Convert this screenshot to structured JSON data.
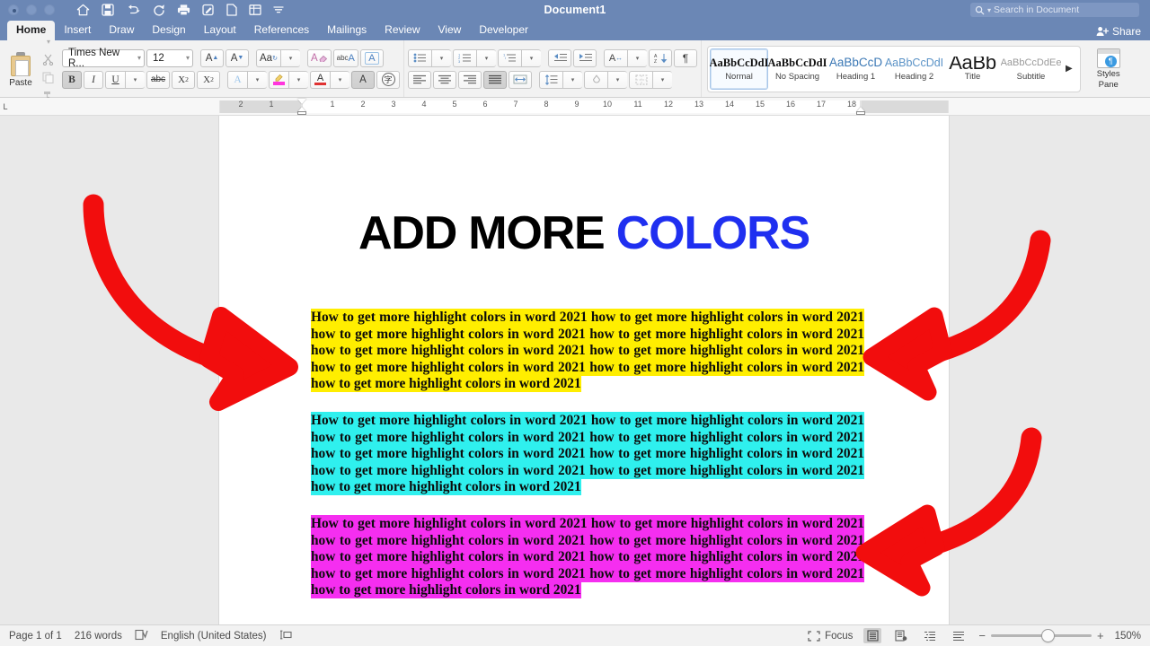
{
  "titlebar": {
    "document_title": "Document1",
    "quick_access": [
      {
        "name": "home-icon",
        "label": "Home"
      },
      {
        "name": "save-icon",
        "label": "Save"
      },
      {
        "name": "undo-icon",
        "label": "Undo"
      },
      {
        "name": "redo-icon",
        "label": "Redo"
      },
      {
        "name": "print-icon",
        "label": "Print"
      },
      {
        "name": "review-icon",
        "label": "Review"
      },
      {
        "name": "new-document-icon",
        "label": "New Document"
      },
      {
        "name": "table-icon",
        "label": "Table"
      },
      {
        "name": "customize-toolbar-icon",
        "label": "Customize"
      }
    ],
    "search_placeholder": "Search in Document",
    "share_label": "Share"
  },
  "tabs": [
    {
      "label": "Home",
      "active": true
    },
    {
      "label": "Insert",
      "active": false
    },
    {
      "label": "Draw",
      "active": false
    },
    {
      "label": "Design",
      "active": false
    },
    {
      "label": "Layout",
      "active": false
    },
    {
      "label": "References",
      "active": false
    },
    {
      "label": "Mailings",
      "active": false
    },
    {
      "label": "Review",
      "active": false
    },
    {
      "label": "View",
      "active": false
    },
    {
      "label": "Developer",
      "active": false
    }
  ],
  "ribbon": {
    "paste_label": "Paste",
    "font_name": "Times New R...",
    "font_size": "12",
    "buttons": {
      "grow_font": "A",
      "shrink_font": "A",
      "change_case": "Aa",
      "clear_formatting": "A",
      "spelling": "abc",
      "text_effects": "A",
      "bold": "B",
      "italic": "I",
      "underline": "U",
      "strikethrough": "abc",
      "subscript": "X",
      "superscript": "X",
      "text_outline": "A",
      "highlight": "A",
      "font_color": "A",
      "shading_char": "A",
      "asian_layout": "字"
    },
    "highlight_color": "#ff35dd",
    "font_color": "#e03232",
    "styles": [
      {
        "preview": "AaBbCcDdI",
        "name": "Normal",
        "selected": true,
        "cls": "s-normal"
      },
      {
        "preview": "AaBbCcDdI",
        "name": "No Spacing",
        "selected": false,
        "cls": "s-nospace"
      },
      {
        "preview": "AaBbCcD",
        "name": "Heading 1",
        "selected": false,
        "cls": "s-h1"
      },
      {
        "preview": "AaBbCcDdI",
        "name": "Heading 2",
        "selected": false,
        "cls": "s-h2"
      },
      {
        "preview": "AaBb",
        "name": "Title",
        "selected": false,
        "cls": "s-title"
      },
      {
        "preview": "AaBbCcDdEe",
        "name": "Subtitle",
        "selected": false,
        "cls": "s-sub"
      }
    ],
    "gallery_more": "▶",
    "styles_pane_label_1": "Styles",
    "styles_pane_label_2": "Pane",
    "styles_pane_badge": "¶"
  },
  "ruler": {
    "corner_mark": "L",
    "left_numbers": [
      "2",
      "1"
    ],
    "numbers": [
      "1",
      "2",
      "3",
      "4",
      "5",
      "6",
      "7",
      "8",
      "9",
      "10",
      "11",
      "12",
      "13",
      "14",
      "15",
      "16",
      "17",
      "18"
    ]
  },
  "document": {
    "heading_black": "ADD MORE",
    "heading_blue": "COLORS",
    "heading_blue_color": "#1f2ff0",
    "body_text": "How to get more highlight colors in word 2021 how to get more highlight colors in word 2021 how to get more highlight colors in word 2021 how to get more highlight colors in word 2021 how to get more highlight colors in word 2021 how to get more highlight colors in word 2021 how to get more highlight colors in word 2021 how to get more highlight colors in word 2021 how to get more highlight colors in word 2021",
    "paragraphs": [
      {
        "name": "paragraph-yellow",
        "highlight": "#ffee00"
      },
      {
        "name": "paragraph-cyan",
        "highlight": "#2ff0ee"
      },
      {
        "name": "paragraph-magenta",
        "highlight": "#f52ef0"
      }
    ],
    "arrow_color": "#f20d0d"
  },
  "statusbar": {
    "page": "Page 1 of 1",
    "words": "216 words",
    "proofing_icon": "proofing-icon",
    "language": "English (United States)",
    "track_changes_icon": "track-changes-icon",
    "focus": "Focus",
    "zoom_level": "150%",
    "zoom_out": "−",
    "zoom_in": "+"
  }
}
